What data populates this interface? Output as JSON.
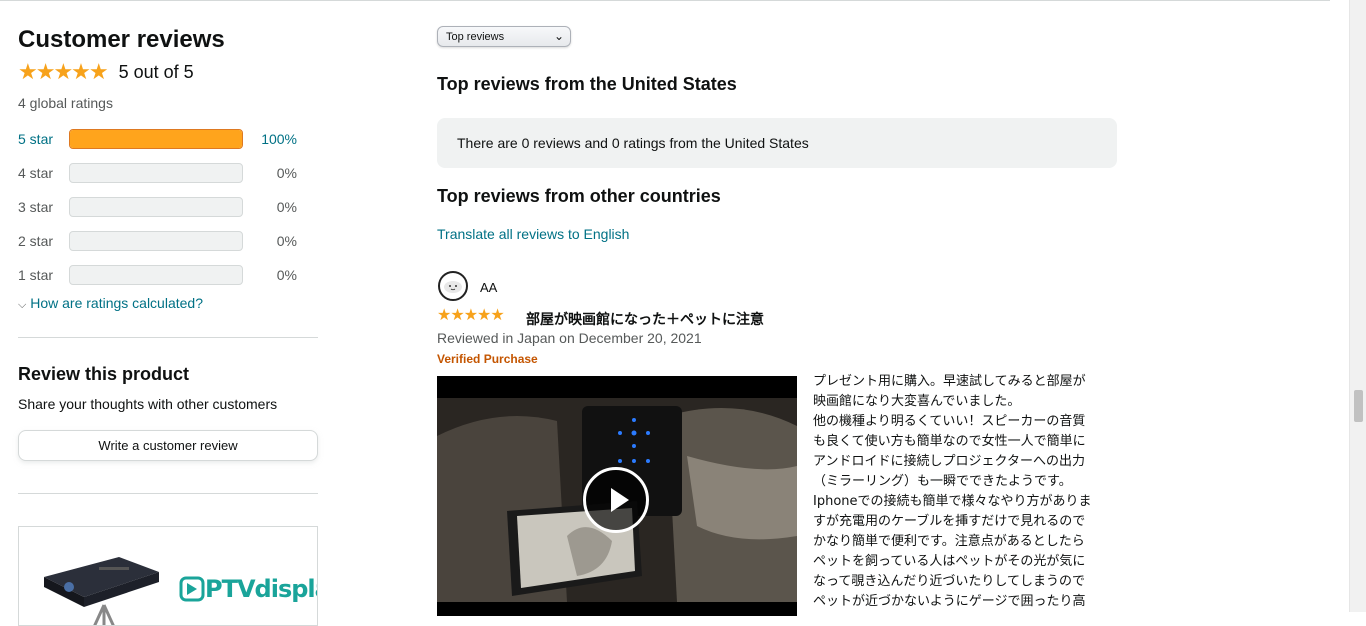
{
  "summary": {
    "title": "Customer reviews",
    "stars": "★★★★★",
    "average_text": "5 out of 5",
    "global_ratings": "4 global ratings",
    "histogram": [
      {
        "label": "5 star",
        "percent_text": "100%",
        "fraction": 1.0
      },
      {
        "label": "4 star",
        "percent_text": "0%",
        "fraction": 0
      },
      {
        "label": "3 star",
        "percent_text": "0%",
        "fraction": 0
      },
      {
        "label": "2 star",
        "percent_text": "0%",
        "fraction": 0
      },
      {
        "label": "1 star",
        "percent_text": "0%",
        "fraction": 0
      }
    ],
    "how_calculated": "How are ratings calculated?"
  },
  "review_product": {
    "title": "Review this product",
    "subtitle": "Share your thoughts with other customers",
    "button": "Write a customer review"
  },
  "ad": {
    "brand": "PTVdisplay"
  },
  "sort": {
    "selected": "Top reviews",
    "chevron": "⌄"
  },
  "us_section": {
    "heading": "Top reviews from the United States",
    "notice": "There are 0 reviews and 0 ratings from the United States"
  },
  "other_section": {
    "heading": "Top reviews from other countries",
    "translate_link": "Translate all reviews to English"
  },
  "review": {
    "reviewer": "AA",
    "stars": "★★★★★",
    "title": "部屋が映画館になった＋ペットに注意",
    "date": "Reviewed in Japan on December 20, 2021",
    "verified": "Verified Purchase",
    "lines": [
      " プレゼント用に購入。早速試してみると部屋が",
      "映画館になり大変喜んでいました。",
      "他の機種より明るくていい！スピーカーの音質",
      "も良くて使い方も簡単なので女性一人で簡単に",
      "アンドロイドに接続しプロジェクターへの出力",
      "（ミラーリング）も一瞬でできたようです。",
      "Iphoneでの接続も簡単で様々なやり方がありま",
      "すが充電用のケーブルを挿すだけで見れるので",
      "かなり簡単で便利です。注意点があるとしたら",
      "ペットを飼っている人はペットがその光が気に",
      "なって覗き込んだり近づいたりしてしまうので",
      "ペットが近づかないようにゲージで囲ったり高"
    ]
  },
  "colors": {
    "star": "#f7a21b",
    "bar_fill": "#ffa41c",
    "link": "#007185",
    "verified": "#c45500"
  }
}
